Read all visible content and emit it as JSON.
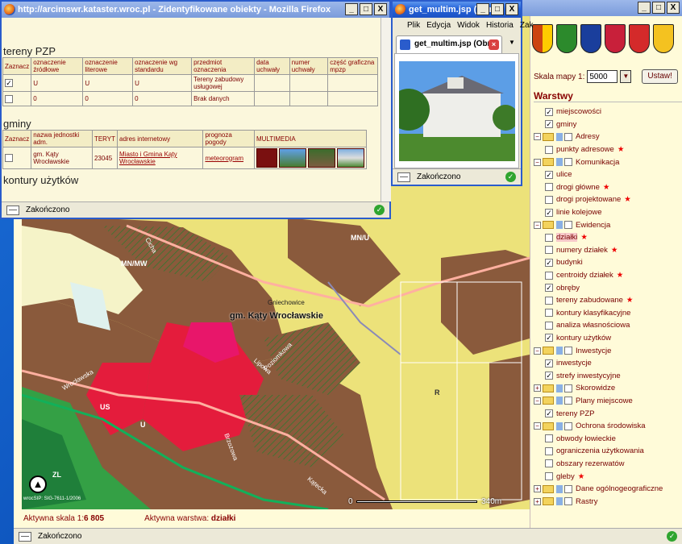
{
  "main": {
    "scale_label": "Skala mapy 1:",
    "scale_value": "5000",
    "set_button": "Ustaw!",
    "layers_title": "Warstwy",
    "layers": [
      {
        "type": "item",
        "label": "miejscowości",
        "checked": true,
        "indent": 1
      },
      {
        "type": "item",
        "label": "gminy",
        "checked": true,
        "indent": 1
      },
      {
        "type": "group",
        "label": "Adresy",
        "indent": 0
      },
      {
        "type": "item",
        "label": "punkty adresowe",
        "checked": false,
        "star": true,
        "indent": 1
      },
      {
        "type": "group",
        "label": "Komunikacja",
        "indent": 0
      },
      {
        "type": "item",
        "label": "ulice",
        "checked": true,
        "indent": 1
      },
      {
        "type": "item",
        "label": "drogi główne",
        "checked": false,
        "star": true,
        "indent": 1
      },
      {
        "type": "item",
        "label": "drogi projektowane",
        "checked": false,
        "star": true,
        "indent": 1
      },
      {
        "type": "item",
        "label": "linie kolejowe",
        "checked": true,
        "indent": 1
      },
      {
        "type": "group",
        "label": "Ewidencja",
        "indent": 0
      },
      {
        "type": "item",
        "label": "działki",
        "checked": false,
        "star": true,
        "highlight": true,
        "indent": 1
      },
      {
        "type": "item",
        "label": "numery działek",
        "checked": false,
        "star": true,
        "indent": 1
      },
      {
        "type": "item",
        "label": "budynki",
        "checked": true,
        "indent": 1
      },
      {
        "type": "item",
        "label": "centroidy działek",
        "checked": false,
        "star": true,
        "indent": 1
      },
      {
        "type": "item",
        "label": "obręby",
        "checked": true,
        "indent": 1
      },
      {
        "type": "item",
        "label": "tereny zabudowane",
        "checked": false,
        "star": true,
        "indent": 1
      },
      {
        "type": "item",
        "label": "kontury klasyfikacyjne",
        "checked": false,
        "indent": 1
      },
      {
        "type": "item",
        "label": "analiza własnościowa",
        "checked": false,
        "indent": 1
      },
      {
        "type": "item",
        "label": "kontury użytków",
        "checked": true,
        "indent": 1
      },
      {
        "type": "group",
        "label": "Inwestycje",
        "indent": 0
      },
      {
        "type": "item",
        "label": "inwestycje",
        "checked": true,
        "indent": 1
      },
      {
        "type": "item",
        "label": "strefy inwestycyjne",
        "checked": true,
        "indent": 1
      },
      {
        "type": "group",
        "label": "Skorowidze",
        "collapsed": true,
        "indent": 0
      },
      {
        "type": "group",
        "label": "Plany miejscowe",
        "indent": 0
      },
      {
        "type": "item",
        "label": "tereny PZP",
        "checked": true,
        "indent": 1
      },
      {
        "type": "group",
        "label": "Ochrona środowiska",
        "indent": 0
      },
      {
        "type": "item",
        "label": "obwody łowieckie",
        "checked": false,
        "indent": 1
      },
      {
        "type": "item",
        "label": "ograniczenia użytkowania",
        "checked": false,
        "indent": 1
      },
      {
        "type": "item",
        "label": "obszary rezerwatów",
        "checked": false,
        "indent": 1
      },
      {
        "type": "item",
        "label": "gleby",
        "checked": false,
        "star": true,
        "indent": 1
      },
      {
        "type": "group",
        "label": "Dane ogólnogeograficzne",
        "collapsed": true,
        "indent": 0
      },
      {
        "type": "group",
        "label": "Rastry",
        "collapsed": true,
        "indent": 0
      }
    ],
    "map_labels": {
      "gmina": "gm. Kąty Wrocławskie",
      "place": "Gniechowice",
      "mnu": "MN/U",
      "mnmw": "MN/MW",
      "us": "US",
      "u": "U",
      "zl": "ZL",
      "r": "R",
      "street1": "Lipowa",
      "street2": "Poziomkowa",
      "street3": "Wrocławska",
      "street4": "Brzozowa",
      "street5": "Kątecka",
      "street6": "Cicha"
    },
    "scalebar_start": "0",
    "scalebar_end": "340m",
    "copyright": "wrocSIP: SIG-7611-1/2006",
    "active_scale_label": "Aktywna skala 1:",
    "active_scale_value": "6 805",
    "active_layer_label": "Aktywna warstwa:",
    "active_layer_value": "działki",
    "status": "Zakończono"
  },
  "attr_window": {
    "title": "http://arcimswr.kataster.wroc.pl - Zidentyfikowane obiekty - Mozilla Firefox",
    "section1": "tereny PZP",
    "table1_headers": [
      "Zaznacz",
      "oznaczenie źródłowe",
      "oznaczenie literowe",
      "oznaczenie wg standardu",
      "przedmiot oznaczenia",
      "data uchwały",
      "numer uchwały",
      "część graficzna mpzp"
    ],
    "table1_rows": [
      {
        "checked": true,
        "cells": [
          "U",
          "U",
          "U",
          "Tereny zabudowy usługowej",
          "",
          "",
          ""
        ]
      },
      {
        "checked": false,
        "cells": [
          "0",
          "0",
          "0",
          "Brak danych",
          "",
          "",
          ""
        ]
      }
    ],
    "section2": "gminy",
    "table2_headers": [
      "Zaznacz",
      "nazwa jednostki adm.",
      "TERYT",
      "adres internetowy",
      "prognoza pogody",
      "MULTIMEDIA"
    ],
    "table2_row": {
      "checked": false,
      "name": "gm. Kąty Wrocławskie",
      "teryt": "23045",
      "url": "Miasto i Gmina Kąty Wrocławskie",
      "weather": "meteorogram"
    },
    "section3": "kontury użytków",
    "status": "Zakończono",
    "buttons": [
      "_",
      "□",
      "X"
    ]
  },
  "mm_window": {
    "title": "get_multim.jsp (Obr...",
    "menu": [
      "Plik",
      "Edycja",
      "Widok",
      "Historia",
      "Zak"
    ],
    "tab": "get_multim.jsp (Obr...",
    "status": "Zakończono",
    "buttons": [
      "_",
      "□",
      "X"
    ]
  },
  "main_window_buttons": [
    "_",
    "□",
    "X"
  ]
}
